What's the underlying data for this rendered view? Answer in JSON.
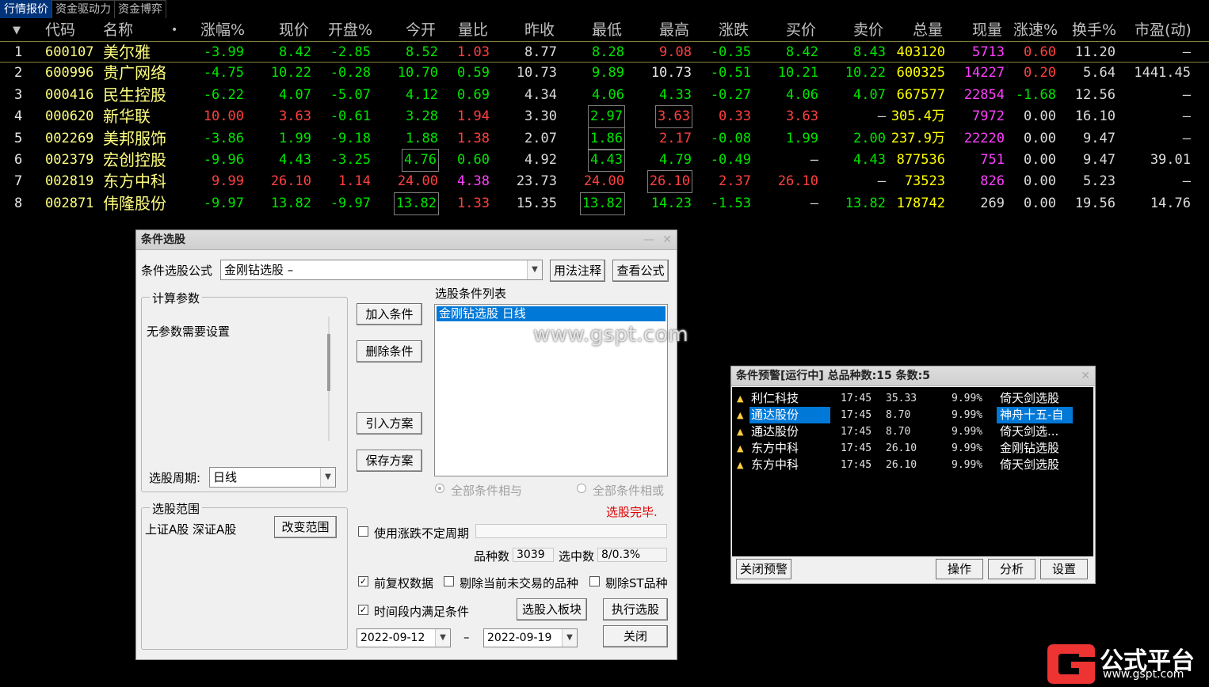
{
  "tabs": [
    "行情报价",
    "资金驱动力",
    "资金博弈"
  ],
  "quote": {
    "headers": [
      "代码",
      "名称",
      "•",
      "涨幅%",
      "现价",
      "开盘%",
      "今开",
      "量比",
      "昨收",
      "最低",
      "最高",
      "涨跌",
      "买价",
      "卖价",
      "总量",
      "现量",
      "涨速%",
      "换手%",
      "市盈(动)"
    ],
    "rows": [
      {
        "no": "1",
        "code": "600107",
        "name": "美尔雅",
        "chg_pct": "-3.99",
        "price": "8.42",
        "open_pct": "-2.85",
        "open": "8.52",
        "vol_ratio": "1.03",
        "prev_close": "8.77",
        "low": "8.28",
        "high": "9.08",
        "change": "-0.35",
        "bid": "8.42",
        "ask": "8.43",
        "volume": "403120",
        "cur_vol": "5713",
        "speed": "0.60",
        "turnover": "11.20",
        "pe": "–"
      },
      {
        "no": "2",
        "code": "600996",
        "name": "贵广网络",
        "chg_pct": "-4.75",
        "price": "10.22",
        "open_pct": "-0.28",
        "open": "10.70",
        "vol_ratio": "0.59",
        "prev_close": "10.73",
        "low": "9.89",
        "high": "10.73",
        "change": "-0.51",
        "bid": "10.21",
        "ask": "10.22",
        "volume": "600325",
        "cur_vol": "14227",
        "speed": "0.20",
        "turnover": "5.64",
        "pe": "1441.45"
      },
      {
        "no": "3",
        "code": "000416",
        "name": "民生控股",
        "chg_pct": "-6.22",
        "price": "4.07",
        "open_pct": "-5.07",
        "open": "4.12",
        "vol_ratio": "0.69",
        "prev_close": "4.34",
        "low": "4.06",
        "high": "4.33",
        "change": "-0.27",
        "bid": "4.06",
        "ask": "4.07",
        "volume": "667577",
        "cur_vol": "22854",
        "speed": "-1.68",
        "turnover": "12.56",
        "pe": "–"
      },
      {
        "no": "4",
        "code": "000620",
        "name": "新华联",
        "chg_pct": "10.00",
        "price": "3.63",
        "open_pct": "-0.61",
        "open": "3.28",
        "vol_ratio": "1.94",
        "prev_close": "3.30",
        "low": "2.97",
        "high": "3.63",
        "change": "0.33",
        "bid": "3.63",
        "ask": "–",
        "volume": "305.4万",
        "cur_vol": "7972",
        "speed": "0.00",
        "turnover": "16.10",
        "pe": "–"
      },
      {
        "no": "5",
        "code": "002269",
        "name": "美邦服饰",
        "chg_pct": "-3.86",
        "price": "1.99",
        "open_pct": "-9.18",
        "open": "1.88",
        "vol_ratio": "1.38",
        "prev_close": "2.07",
        "low": "1.86",
        "high": "2.17",
        "change": "-0.08",
        "bid": "1.99",
        "ask": "2.00",
        "volume": "237.9万",
        "cur_vol": "22220",
        "speed": "0.00",
        "turnover": "9.47",
        "pe": "–"
      },
      {
        "no": "6",
        "code": "002379",
        "name": "宏创控股",
        "chg_pct": "-9.96",
        "price": "4.43",
        "open_pct": "-3.25",
        "open": "4.76",
        "vol_ratio": "0.60",
        "prev_close": "4.92",
        "low": "4.43",
        "high": "4.79",
        "change": "-0.49",
        "bid": "–",
        "ask": "4.43",
        "volume": "877536",
        "cur_vol": "751",
        "speed": "0.00",
        "turnover": "9.47",
        "pe": "39.01"
      },
      {
        "no": "7",
        "code": "002819",
        "name": "东方中科",
        "chg_pct": "9.99",
        "price": "26.10",
        "open_pct": "1.14",
        "open": "24.00",
        "vol_ratio": "4.38",
        "prev_close": "23.73",
        "low": "24.00",
        "high": "26.10",
        "change": "2.37",
        "bid": "26.10",
        "ask": "–",
        "volume": "73523",
        "cur_vol": "826",
        "speed": "0.00",
        "turnover": "5.23",
        "pe": "–"
      },
      {
        "no": "8",
        "code": "002871",
        "name": "伟隆股份",
        "chg_pct": "-9.97",
        "price": "13.82",
        "open_pct": "-9.97",
        "open": "13.82",
        "vol_ratio": "1.33",
        "prev_close": "15.35",
        "low": "13.82",
        "high": "14.23",
        "change": "-1.53",
        "bid": "–",
        "ask": "13.82",
        "volume": "178742",
        "cur_vol": "269",
        "speed": "0.00",
        "turnover": "19.56",
        "pe": "14.76"
      }
    ]
  },
  "screener": {
    "title": "条件选股",
    "formula_label": "条件选股公式",
    "formula_value": "金刚钻选股    –",
    "usage_btn": "用法注释",
    "view_formula_btn": "查看公式",
    "params_group": "计算参数",
    "params_text": "无参数需要设置",
    "period_label": "选股周期:",
    "period_value": "日线",
    "add_cond": "加入条件",
    "del_cond": "删除条件",
    "import_plan": "引入方案",
    "save_plan": "保存方案",
    "cond_list_label": "选股条件列表",
    "cond_items": [
      "金刚钻选股  日线"
    ],
    "radio_and": "全部条件相与",
    "radio_or": "全部条件相或",
    "done_text": "选股完毕.",
    "range_group": "选股范围",
    "range_text": "上证A股 深证A股",
    "change_range": "改变范围",
    "use_var_period": "使用涨跌不定周期",
    "count_label": "品种数",
    "count_value": "3039",
    "selected_label": "选中数",
    "selected_value": "8/0.3%",
    "adj_data": "前复权数据",
    "exclude_untraded": "剔除当前未交易的品种",
    "exclude_st": "剔除ST品种",
    "time_range": "时间段内满足条件",
    "to_block": "选股入板块",
    "run": "执行选股",
    "date_from": "2022-09-12",
    "date_sep": "–",
    "date_to": "2022-09-19",
    "close": "关闭"
  },
  "watermark": "www.gspt.com",
  "alert": {
    "title": "条件预警[运行中] 总品种数:15 条数:5",
    "rows": [
      {
        "name": "利仁科技",
        "time": "17:45",
        "price": "35.33",
        "pct": "9.99%",
        "formula": "倚天剑选股"
      },
      {
        "name": "通达股份",
        "time": "17:45",
        "price": "8.70",
        "pct": "9.99%",
        "formula": "神舟十五-自"
      },
      {
        "name": "通达股份",
        "time": "17:45",
        "price": "8.70",
        "pct": "9.99%",
        "formula": "倚天剑选..."
      },
      {
        "name": "东方中科",
        "time": "17:45",
        "price": "26.10",
        "pct": "9.99%",
        "formula": "金刚钻选股"
      },
      {
        "name": "东方中科",
        "time": "17:45",
        "price": "26.10",
        "pct": "9.99%",
        "formula": "倚天剑选股"
      }
    ],
    "close_btn": "关闭预警",
    "op_btn": "操作",
    "analyze_btn": "分析",
    "settings_btn": "设置"
  },
  "logo": {
    "name": "公式平台",
    "url": "www.gspt.com"
  },
  "colors": {
    "up": "#ff4040",
    "down": "#00e600",
    "code": "#ffff80",
    "highlight": "#0078d7",
    "accent_tab": "#00337a"
  }
}
